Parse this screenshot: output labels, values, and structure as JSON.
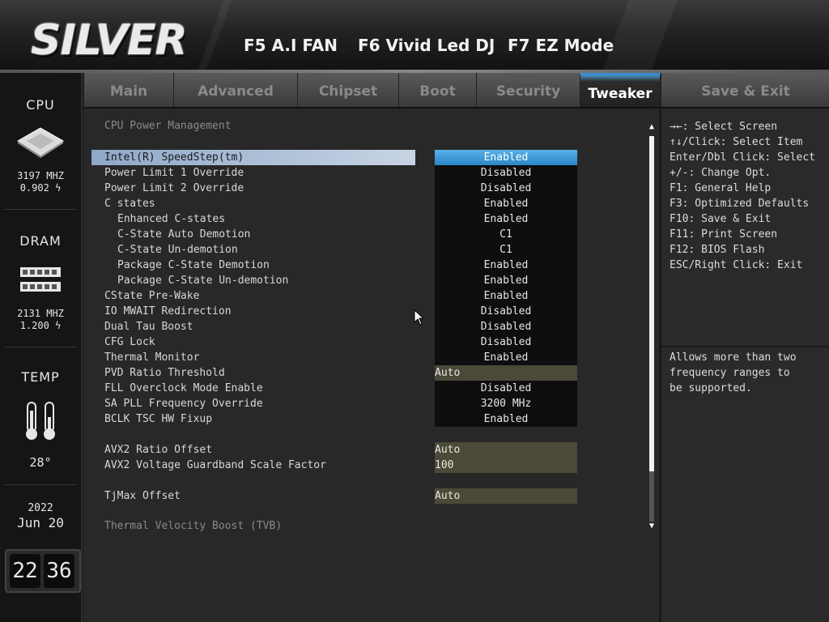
{
  "header": {
    "brand": "SILVER",
    "hotkeys": [
      {
        "label": "F5 A.I FAN"
      },
      {
        "label": "F6 Vivid Led DJ"
      },
      {
        "label": "F7 EZ Mode"
      }
    ]
  },
  "left_panel": {
    "cpu": {
      "title": "CPU",
      "freq": "3197 MHZ",
      "volt": "0.902"
    },
    "dram": {
      "title": "DRAM",
      "freq": "2131 MHZ",
      "volt": "1.200"
    },
    "temp": {
      "title": "TEMP",
      "value": "28°"
    },
    "date": {
      "year": "2022",
      "month_day": "Jun 20"
    },
    "clock": {
      "hour": "22",
      "minute": "36"
    }
  },
  "tabs": [
    {
      "label": "Main"
    },
    {
      "label": "Advanced"
    },
    {
      "label": "Chipset"
    },
    {
      "label": "Boot"
    },
    {
      "label": "Security"
    },
    {
      "label": "Tweaker",
      "active": true
    },
    {
      "label": "Save & Exit"
    }
  ],
  "main": {
    "section_title": "CPU Power Management",
    "items": [
      {
        "label": "Intel(R) SpeedStep(tm)",
        "value": "Enabled"
      },
      {
        "label": "Power Limit 1 Override",
        "value": "Disabled"
      },
      {
        "label": "Power Limit 2 Override",
        "value": "Disabled"
      },
      {
        "label": "C states",
        "value": "Enabled"
      },
      {
        "label": "Enhanced C-states",
        "value": "Enabled"
      },
      {
        "label": "C-State Auto Demotion",
        "value": "C1"
      },
      {
        "label": "C-State Un-demotion",
        "value": "C1"
      },
      {
        "label": "Package C-State Demotion",
        "value": "Enabled"
      },
      {
        "label": "Package C-State Un-demotion",
        "value": "Enabled"
      },
      {
        "label": "CState Pre-Wake",
        "value": "Enabled"
      },
      {
        "label": "IO MWAIT Redirection",
        "value": "Disabled"
      },
      {
        "label": "Dual Tau Boost",
        "value": "Disabled"
      },
      {
        "label": "CFG Lock",
        "value": "Disabled"
      },
      {
        "label": "Thermal Monitor",
        "value": "Enabled"
      },
      {
        "label": "PVD Ratio Threshold",
        "value": "Auto"
      },
      {
        "label": "FLL Overclock Mode Enable",
        "value": "Disabled"
      },
      {
        "label": "SA PLL Frequency Override",
        "value": "3200 MHz"
      },
      {
        "label": "BCLK TSC HW Fixup",
        "value": "Enabled"
      },
      {
        "label": "AVX2 Ratio Offset",
        "value": "Auto"
      },
      {
        "label": "AVX2 Voltage Guardband Scale Factor",
        "value": "100"
      },
      {
        "label": "TjMax Offset",
        "value": "Auto"
      }
    ],
    "footer_section": "Thermal Velocity Boost (TVB)"
  },
  "help": {
    "keys": [
      "→←: Select Screen",
      "↑↓/Click: Select Item",
      "Enter/Dbl Click: Select",
      "+/-: Change Opt.",
      "F1: General Help",
      "F3: Optimized Defaults",
      "F10: Save & Exit",
      "F11: Print Screen",
      "F12: BIOS Flash",
      "ESC/Right Click: Exit"
    ],
    "description": [
      "Allows more than two",
      "frequency ranges to",
      "be supported."
    ]
  },
  "colors": {
    "accent": "#2a86c8",
    "input_bg": "#4b4a38",
    "selected_row": "#c8d4e4"
  }
}
